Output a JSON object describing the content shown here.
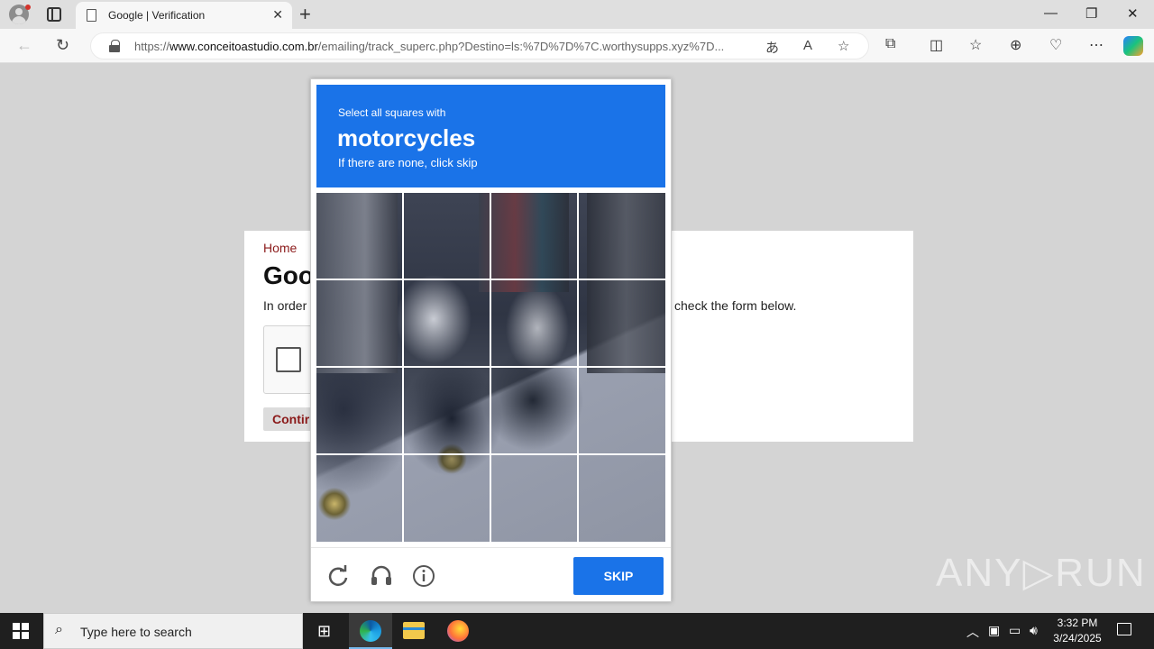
{
  "browser": {
    "tab_title": "Google | Verification",
    "tab_close": "✕",
    "new_tab": "+",
    "url_prefix": "https://",
    "url_domain": "www.conceitoastudio.com.br",
    "url_rest": "/emailing/track_superc.php?Destino=ls:%7D%7D%7C.worthysupps.xyz%7D...",
    "window_controls": {
      "minimize": "—",
      "restore": "❐",
      "close": "✕"
    }
  },
  "page": {
    "breadcrumb": "Home",
    "title": "Goo",
    "description": "In order",
    "description_tail": "check the form below.",
    "continue_label": "Contir"
  },
  "challenge": {
    "instruction": "Select all squares with",
    "keyword": "motorcycles",
    "hint": "If there are none, click skip",
    "skip_label": "SKIP",
    "icons": [
      "reload-icon",
      "audio-icon",
      "info-icon"
    ]
  },
  "watermark": "ANY▷RUN",
  "taskbar": {
    "search_placeholder": "Type here to search",
    "time": "3:32 PM",
    "date": "3/24/2025",
    "apps": [
      "task-view-icon",
      "edge-icon",
      "file-explorer-icon",
      "firefox-icon"
    ]
  },
  "colors": {
    "accent_blue": "#1a73e8",
    "breadcrumb_red": "#8b1a1a",
    "taskbar": "#1f1f1f"
  }
}
